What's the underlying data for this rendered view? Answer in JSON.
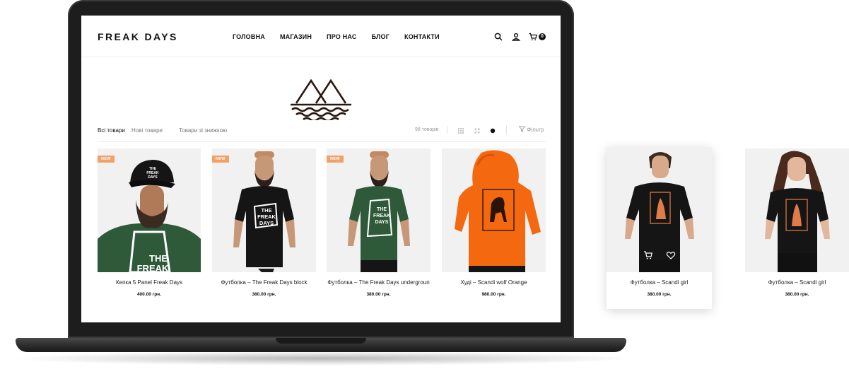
{
  "site": {
    "logo": "FREAK DAYS",
    "nav": [
      "ГОЛОВНА",
      "МАГАЗИН",
      "ПРО НАС",
      "БЛОГ",
      "КОНТАКТИ"
    ],
    "cart_count": "0"
  },
  "toolbar": {
    "tabs": [
      "Всі товари",
      "Нові товари",
      "Товари зі знижкою"
    ],
    "count": "98 товарів",
    "filter_label": "Фільтр"
  },
  "products": [
    {
      "name": "Кепка 5 Panel Freak Days",
      "price": "400.00 грн.",
      "badge": "NEW"
    },
    {
      "name": "Футболка – The Freak Days block",
      "price": "380.00 грн.",
      "badge": "NEW"
    },
    {
      "name": "Футболка – The Freak Days undergroun",
      "price": "380.00 грн.",
      "badge": "NEW"
    },
    {
      "name": "Худі – Scandi wolf Orange",
      "price": "980.00 грн."
    },
    {
      "name": "Футболка – Scandi girl",
      "price": "380.00 грн."
    },
    {
      "name": "Футболка – Scandi girl",
      "price": "380.00 грн."
    }
  ],
  "shirt_prints": {
    "the": "THE",
    "freak": "FREAK",
    "days": "DAYS"
  },
  "icons": [
    "search-icon",
    "user-icon",
    "cart-icon",
    "grid-icon",
    "grid-small-icon",
    "list-icon",
    "filter-icon",
    "add-to-cart-icon",
    "heart-icon"
  ],
  "colors": {
    "badge": "#f3a167",
    "hoodie": "#f4680f",
    "tee_green": "#2e5a3a",
    "tee_black": "#151515",
    "photo_bg": "#f1f1f1"
  }
}
